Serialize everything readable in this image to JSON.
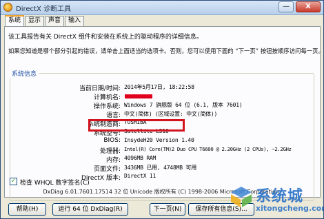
{
  "window": {
    "title": "DirectX 诊断工具",
    "minimize_glyph": "—",
    "close_glyph": "X"
  },
  "tabs": [
    {
      "label": "系统",
      "active": true
    },
    {
      "label": "显示",
      "active": false
    },
    {
      "label": "声音",
      "active": false
    },
    {
      "label": "输入",
      "active": false
    }
  ],
  "intro": {
    "line1": "该工具报告有关 DirectX 组件和安装在系统上的驱动程序的详细信息。",
    "line2": "如果您知道是哪个部分引起的错误，请单击上面适当的选项卡。否则，您可以使用下面的 “下一页” 按钮按顺序访问每一页。"
  },
  "system_info": {
    "title": "系统信息",
    "rows": [
      {
        "label": "当前日期/时间:",
        "value": "2014年5月17日, 18:22:58"
      },
      {
        "label": "计算机名:",
        "value": ""
      },
      {
        "label": "操作系统:",
        "value": "Windows 7 旗舰版 64 位 (6.1, 版本 7601)"
      },
      {
        "label": "语言:",
        "value": "中文(简体) (区域设置: 中文(简体))"
      },
      {
        "label": "系统制造商:",
        "value": "TOSHIBA"
      },
      {
        "label": "系统型号:",
        "value": "Satellite L510"
      },
      {
        "label": "BIOS:",
        "value": "InsydeH20 Version 1.40"
      },
      {
        "label": "处理器:",
        "value": "Intel(R) Core(TM)2 Duo CPU     T6600  @ 2.20GHz (2 CPUs), ~2.2GHz"
      },
      {
        "label": "内存:",
        "value": "4096MB RAM"
      },
      {
        "label": "页面文件:",
        "value": "3436MB 已用, 4748MB 可用"
      },
      {
        "label": "DirectX 版本:",
        "value": "DirectX 11"
      }
    ]
  },
  "whql_checkbox": {
    "label": "检查 WHQL 数字签名(C)",
    "checked": true,
    "check_glyph": "✓"
  },
  "footer": {
    "version_line": "DxDiag 6.01.7601.17514 32 位 Unicode  版权所有 (C) 1998-2006 Microsoft Corporation."
  },
  "buttons": {
    "help": "帮助(H)",
    "run64": "运行 64 位 DxDiag(R)",
    "next": "下一页(N)",
    "save": "保存所有信息(S)..."
  },
  "watermark": {
    "text_cn": "系统城",
    "url": "xitongcheng.com"
  },
  "colors": {
    "highlight_border": "#d2141e",
    "redaction": "#e0001b",
    "group_title": "#1f4fa0",
    "watermark": "#2d74c9"
  }
}
